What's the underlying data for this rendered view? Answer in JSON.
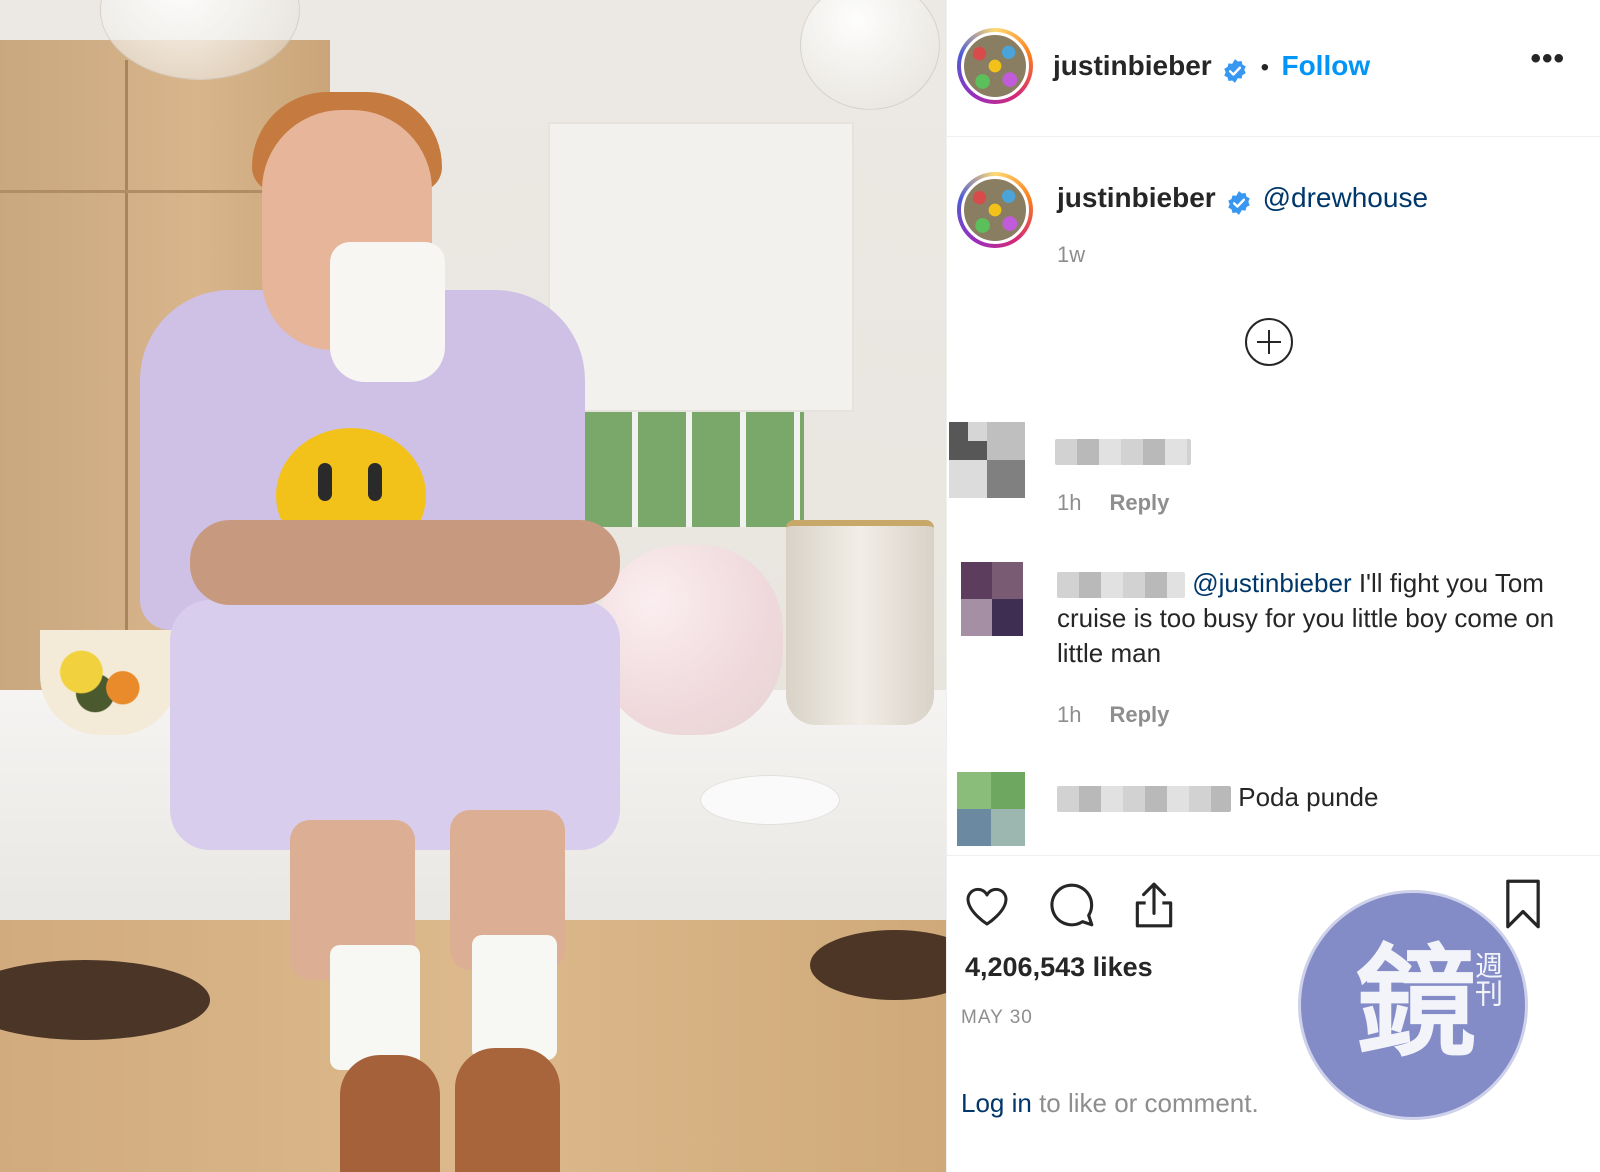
{
  "post": {
    "username": "justinbieber",
    "follow_label": "Follow",
    "separator": "•",
    "more_label": "•••",
    "caption_mention": "@drewhouse",
    "caption_time": "1w",
    "likes": "4,206,543 likes",
    "date": "MAY 30"
  },
  "comments": [
    {
      "text": "",
      "time": "1h",
      "reply_label": "Reply"
    },
    {
      "mention": "@justinbieber",
      "text": " I'll fight you Tom cruise is too busy for you little boy come on little man",
      "time": "1h",
      "reply_label": "Reply"
    },
    {
      "text": "Poda punde"
    }
  ],
  "footer": {
    "login_link": "Log in",
    "login_rest": " to like or comment."
  },
  "watermark": {
    "main": "鏡",
    "sub": "週刊"
  },
  "colors": {
    "link_blue": "#0095f6",
    "mention_blue": "#00376b",
    "muted": "#8e8e8e",
    "text": "#262626"
  },
  "icons": [
    "verified-badge-icon",
    "more-options-icon",
    "load-more-comments-icon",
    "like-heart-icon",
    "comment-bubble-icon",
    "share-icon",
    "save-bookmark-icon"
  ]
}
